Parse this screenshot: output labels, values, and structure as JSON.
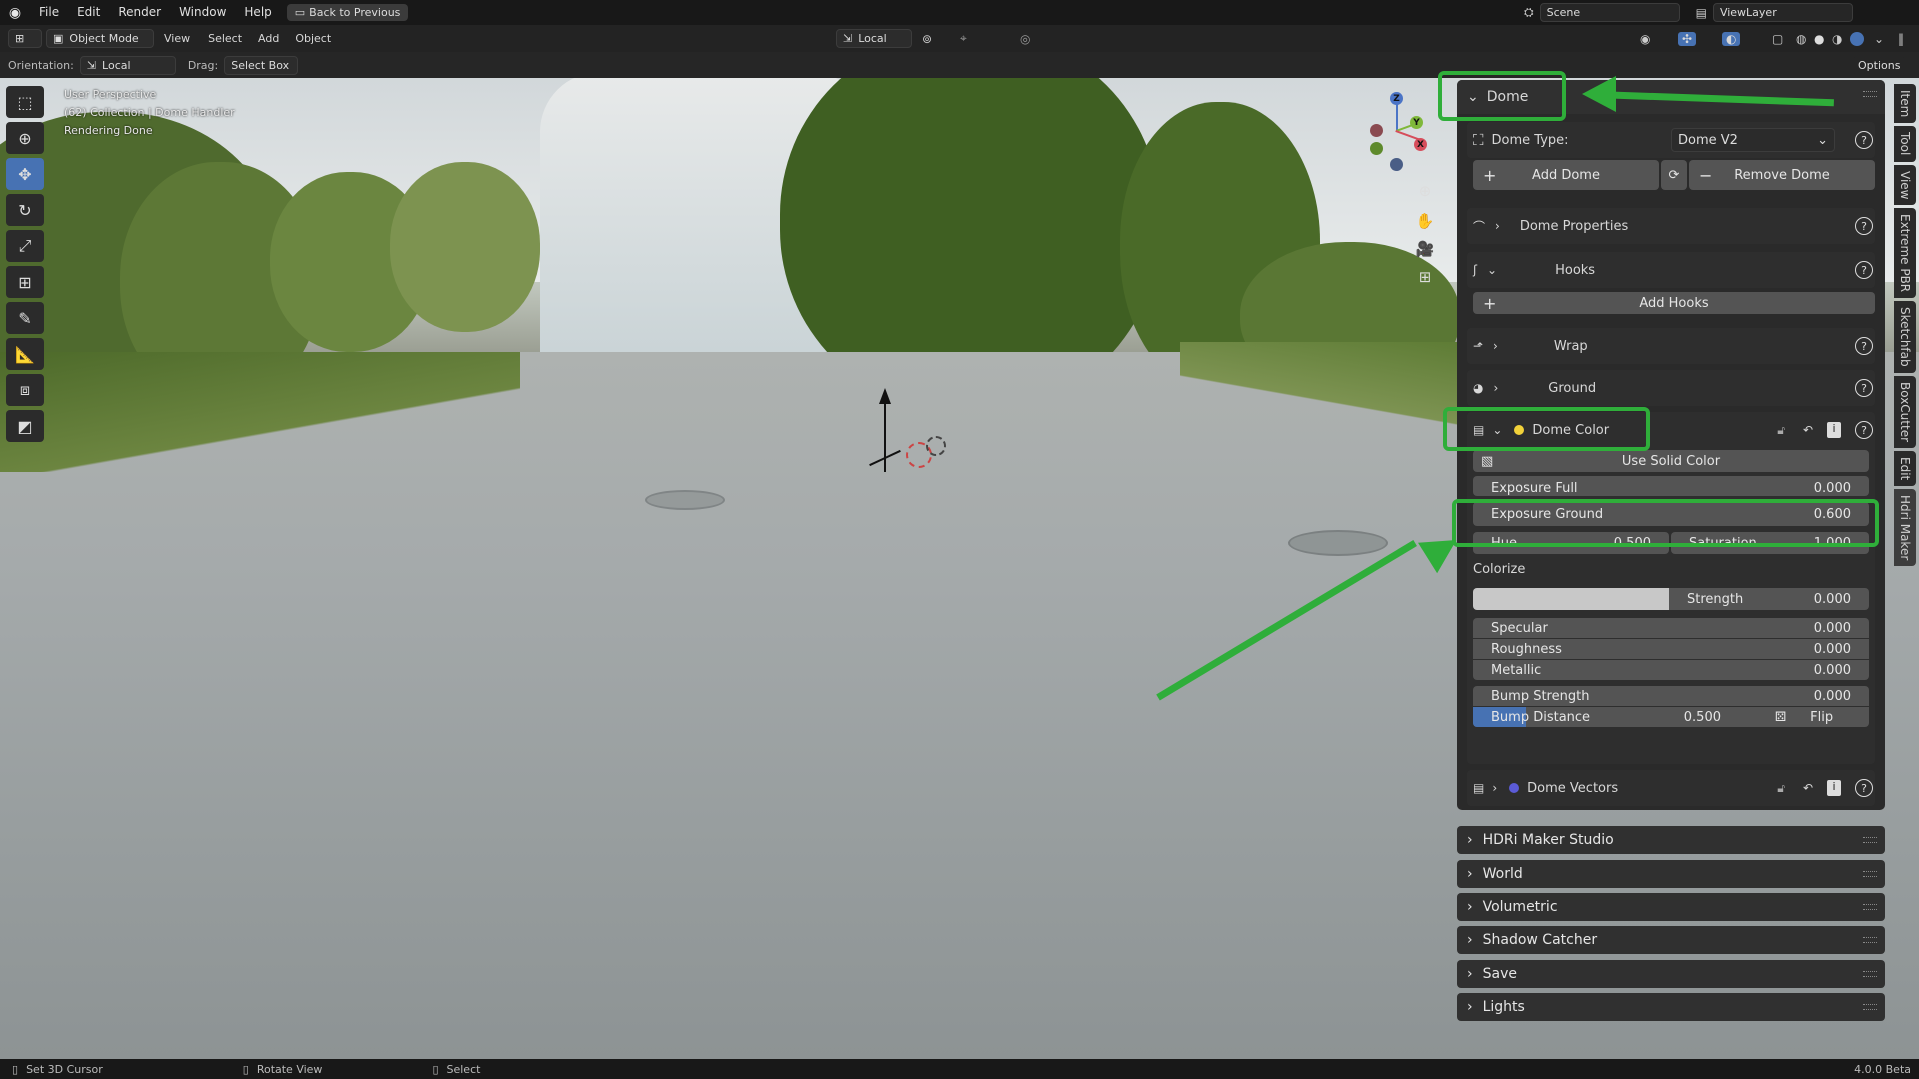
{
  "topbar": {
    "menus": [
      "File",
      "Edit",
      "Render",
      "Window",
      "Help"
    ],
    "back_label": "Back to Previous",
    "scene": "Scene",
    "view_layer": "ViewLayer"
  },
  "header": {
    "mode": "Object Mode",
    "menus": [
      "View",
      "Select",
      "Add",
      "Object"
    ],
    "transform": "Local",
    "options": "Options"
  },
  "toolsettings": {
    "orientation_label": "Orientation:",
    "orientation": "Local",
    "drag_label": "Drag:",
    "drag": "Select Box"
  },
  "viewport": {
    "info": [
      "User Perspective",
      "(62) Collection | Dome Handler",
      "Rendering Done"
    ]
  },
  "gizmo": {
    "z": "Z",
    "y": "Y",
    "x": "X"
  },
  "dome": {
    "title": "Dome",
    "type_label": "Dome Type:",
    "type_value": "Dome V2",
    "add_dome": "Add Dome",
    "remove_dome": "Remove Dome",
    "properties": "Dome Properties",
    "hooks": "Hooks",
    "add_hooks": "Add Hooks",
    "wrap": "Wrap",
    "ground": "Ground",
    "color": {
      "title": "Dome Color",
      "use_solid": "Use Solid Color",
      "exposure_full_label": "Exposure Full",
      "exposure_full": "0.000",
      "exposure_ground_label": "Exposure Ground",
      "exposure_ground": "0.600",
      "hue_label": "Hue",
      "hue": "0.500",
      "saturation_label": "Saturation",
      "saturation": "1.000",
      "colorize": "Colorize",
      "strength_label": "Strength",
      "strength": "0.000",
      "specular_label": "Specular",
      "specular": "0.000",
      "roughness_label": "Roughness",
      "roughness": "0.000",
      "metallic_label": "Metallic",
      "metallic": "0.000",
      "bump_strength_label": "Bump Strength",
      "bump_strength": "0.000",
      "bump_distance_label": "Bump Distance",
      "bump_distance": "0.500",
      "bump_distance_fill": 0.2,
      "flip": "Flip"
    },
    "vectors": "Dome Vectors"
  },
  "panels": [
    "HDRi Maker Studio",
    "World",
    "Volumetric",
    "Shadow Catcher",
    "Save",
    "Lights"
  ],
  "sidebar_tabs": [
    "Item",
    "Tool",
    "View",
    "Extreme PBR",
    "Sketchfab",
    "BoxCutter",
    "Edit",
    "Hdri Maker"
  ],
  "statusbar": {
    "left": "Set 3D Cursor",
    "middle": "Rotate View",
    "right": "Select",
    "version": "4.0.0 Beta"
  },
  "colors": {
    "accent_green": "#2fae3a",
    "accent_blue": "#4772b3",
    "dome_color_dot": "#f2d23a",
    "dome_vectors_dot": "#5b5bd6"
  }
}
